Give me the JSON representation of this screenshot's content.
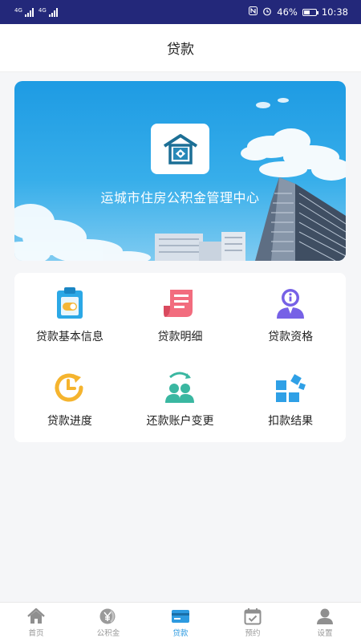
{
  "status_bar": {
    "carrier_1": "4G",
    "carrier_2": "4G",
    "battery_percent": "46%",
    "time": "10:38"
  },
  "header": {
    "title": "贷款"
  },
  "banner": {
    "title": "运城市住房公积金管理中心"
  },
  "grid": {
    "items": [
      {
        "label": "贷款基本信息",
        "icon": "clipboard-toggle-icon"
      },
      {
        "label": "贷款明细",
        "icon": "receipt-list-icon"
      },
      {
        "label": "贷款资格",
        "icon": "user-info-icon"
      },
      {
        "label": "贷款进度",
        "icon": "clock-arrow-icon"
      },
      {
        "label": "还款账户变更",
        "icon": "users-swap-icon"
      },
      {
        "label": "扣款结果",
        "icon": "blocks-icon"
      }
    ]
  },
  "bottom_nav": {
    "items": [
      {
        "label": "首页",
        "icon": "home-icon"
      },
      {
        "label": "公积金",
        "icon": "yen-coin-icon"
      },
      {
        "label": "贷款",
        "icon": "card-icon",
        "active": true
      },
      {
        "label": "预约",
        "icon": "calendar-check-icon"
      },
      {
        "label": "设置",
        "icon": "person-icon"
      }
    ]
  },
  "colors": {
    "status_bar": "#23287a",
    "accent": "#2d9ae0",
    "banner_top": "#1e9be3"
  }
}
